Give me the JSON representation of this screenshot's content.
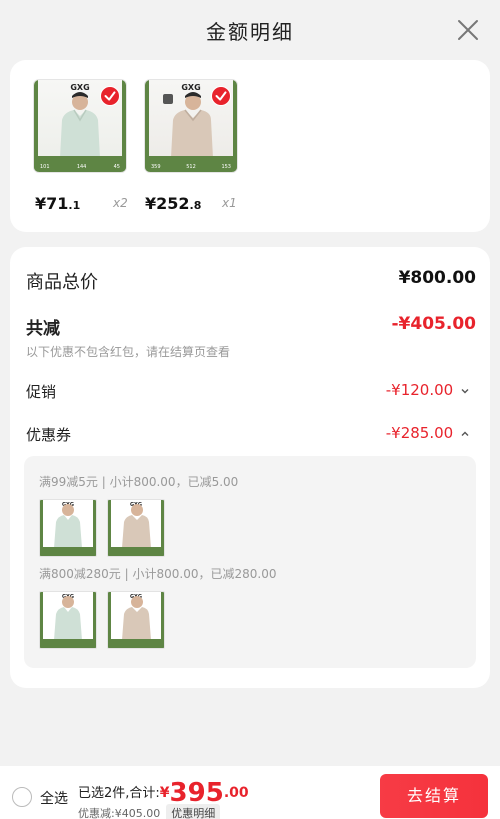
{
  "header": {
    "title": "金额明细"
  },
  "products": [
    {
      "brand": "GXG",
      "price_main": "¥71",
      "price_dec": ".1",
      "qty": "x2",
      "stats": [
        "101",
        "144",
        "45"
      ],
      "shirt_color": "#cfe0d6"
    },
    {
      "brand": "GXG",
      "price_main": "¥252",
      "price_dec": ".8",
      "qty": "x1",
      "stats": [
        "359",
        "512",
        "153"
      ],
      "shirt_color": "#d9c8b8"
    }
  ],
  "detail": {
    "total_label": "商品总价",
    "total_value": "¥800.00",
    "discount_label": "共减",
    "discount_value": "-¥405.00",
    "discount_note": "以下优惠不包含红包，请在结算页查看",
    "promo_label": "促销",
    "promo_value": "-¥120.00",
    "coupon_label": "优惠券",
    "coupon_value": "-¥285.00",
    "coupons": [
      {
        "rule": "满99减5元 | 小计800.00，已减5.00"
      },
      {
        "rule": "满800减280元 | 小计800.00，已减280.00"
      }
    ]
  },
  "footer": {
    "select_all": "全选",
    "selected_text": "已选2件,合计:",
    "currency": "¥",
    "total_int": "395",
    "total_dec": ".00",
    "saved_text": "优惠减:¥405.00",
    "detail_tag": "优惠明细",
    "checkout_label": "去结算"
  },
  "colors": {
    "accent": "#e8232c",
    "frame_green": "#5e8544"
  }
}
